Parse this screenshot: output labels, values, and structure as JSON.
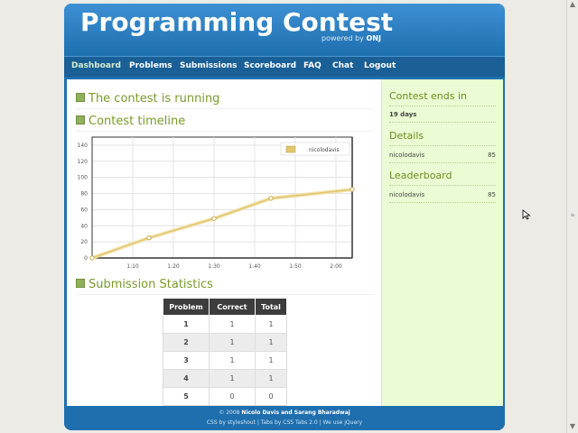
{
  "header": {
    "title": "Programming Contest",
    "powered_prefix": "powered by",
    "powered_brand": "ONJ"
  },
  "nav": {
    "items": [
      "Dashboard",
      "Problems",
      "Submissions",
      "Scoreboard",
      "FAQ",
      "Chat",
      "Logout"
    ],
    "active": "Dashboard"
  },
  "main": {
    "status_title": "The contest is running",
    "timeline_title": "Contest timeline",
    "stats_title": "Submission Statistics",
    "stats_table": {
      "headers": [
        "Problem",
        "Correct",
        "Total"
      ],
      "rows": [
        [
          "1",
          "1",
          "1"
        ],
        [
          "2",
          "1",
          "1"
        ],
        [
          "3",
          "1",
          "1"
        ],
        [
          "4",
          "1",
          "1"
        ],
        [
          "5",
          "0",
          "0"
        ]
      ]
    }
  },
  "chart_data": {
    "type": "line",
    "x": [
      "1:00",
      "1:14",
      "1:30",
      "1:44",
      "2:04"
    ],
    "series": [
      {
        "name": "nicolodavis",
        "values": [
          0,
          25,
          49,
          74,
          85
        ],
        "color": "#e2c76d"
      }
    ],
    "x_tick_labels": [
      "1:10",
      "1:20",
      "1:30",
      "1:40",
      "1:50",
      "2:00"
    ],
    "y_tick_labels": [
      "0",
      "20",
      "40",
      "60",
      "80",
      "100",
      "120",
      "140"
    ],
    "ylim": [
      0,
      150
    ],
    "grid": true,
    "legend_position": "top-right"
  },
  "sidebar": {
    "ends_title": "Contest ends in",
    "ends_value": "19 days",
    "details_title": "Details",
    "details_row": {
      "name": "nicolodavis",
      "value": "85"
    },
    "leaderboard_title": "Leaderboard",
    "leaderboard_row": {
      "name": "nicolodavis",
      "value": "85"
    }
  },
  "footer": {
    "line1_prefix": "© 2008",
    "line1_authors": "Nicolo Davis and Sarang Bharadwaj",
    "line2": "CSS by styleshout | Tabs by CSS Tabs 2.0 | We use jQuery"
  },
  "colors": {
    "brand_blue": "#1f6fae",
    "accent_green": "#7a9a2a",
    "sidebar_bg": "#eafcd3"
  }
}
